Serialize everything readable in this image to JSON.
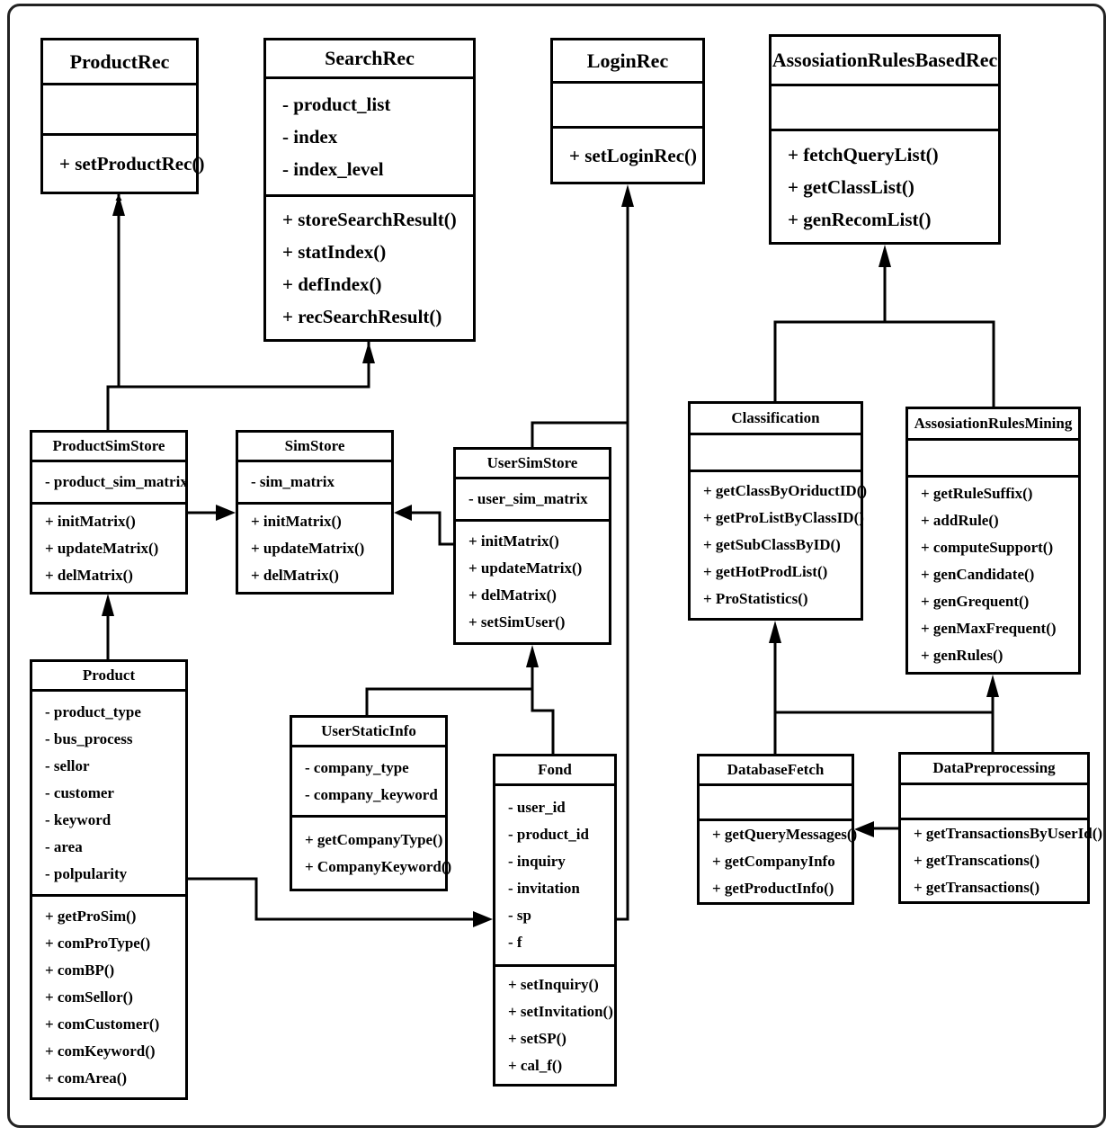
{
  "diagram": {
    "type": "UML class diagram",
    "classes": {
      "productRec": {
        "name": "ProductRec",
        "attributes": [],
        "operations": [
          "+ setProductRec()"
        ]
      },
      "searchRec": {
        "name": "SearchRec",
        "attributes": [
          "- product_list",
          "- index",
          "- index_level"
        ],
        "operations": [
          "+ storeSearchResult()",
          "+ statIndex()",
          "+ defIndex()",
          "+ recSearchResult()"
        ]
      },
      "loginRec": {
        "name": "LoginRec",
        "attributes": [],
        "operations": [
          "+ setLoginRec()"
        ]
      },
      "assocRulesBasedRec": {
        "name": "AssosiationRulesBasedRec",
        "attributes": [],
        "operations": [
          "+ fetchQueryList()",
          "+ getClassList()",
          "+ genRecomList()"
        ]
      },
      "productSimStore": {
        "name": "ProductSimStore",
        "attributes": [
          "- product_sim_matrix"
        ],
        "operations": [
          "+ initMatrix()",
          "+ updateMatrix()",
          "+ delMatrix()"
        ]
      },
      "simStore": {
        "name": "SimStore",
        "attributes": [
          "- sim_matrix"
        ],
        "operations": [
          "+ initMatrix()",
          "+ updateMatrix()",
          "+ delMatrix()"
        ]
      },
      "userSimStore": {
        "name": "UserSimStore",
        "attributes": [
          "- user_sim_matrix"
        ],
        "operations": [
          "+ initMatrix()",
          "+ updateMatrix()",
          "+ delMatrix()",
          "+ setSimUser()"
        ]
      },
      "classification": {
        "name": "Classification",
        "attributes": [],
        "operations": [
          "+ getClassByOriductID()",
          "+ getProListByClassID()",
          "+ getSubClassByID()",
          "+ getHotProdList()",
          "+ ProStatistics()"
        ]
      },
      "assocRulesMining": {
        "name": "AssosiationRulesMining",
        "attributes": [],
        "operations": [
          "+ getRuleSuffix()",
          "+ addRule()",
          "+ computeSupport()",
          "+ genCandidate()",
          "+ genGrequent()",
          "+ genMaxFrequent()",
          "+ genRules()"
        ]
      },
      "product": {
        "name": "Product",
        "attributes": [
          "- product_type",
          "- bus_process",
          "- sellor",
          "- customer",
          "- keyword",
          "- area",
          "- polpularity"
        ],
        "operations": [
          "+ getProSim()",
          "+ comProType()",
          "+ comBP()",
          "+ comSellor()",
          "+ comCustomer()",
          "+ comKeyword()",
          "+ comArea()"
        ]
      },
      "userStaticInfo": {
        "name": "UserStaticInfo",
        "attributes": [
          "- company_type",
          "- company_keyword"
        ],
        "operations": [
          "+ getCompanyType()",
          "+ CompanyKeyword()"
        ]
      },
      "fond": {
        "name": "Fond",
        "attributes": [
          "- user_id",
          "- product_id",
          "- inquiry",
          "- invitation",
          "- sp",
          "- f"
        ],
        "operations": [
          "+ setInquiry()",
          "+ setInvitation()",
          "+ setSP()",
          "+ cal_f()"
        ]
      },
      "databaseFetch": {
        "name": "DatabaseFetch",
        "attributes": [],
        "operations": [
          "+ getQueryMessages()",
          "+ getCompanyInfo",
          "+ getProductInfo()"
        ]
      },
      "dataPreprocessing": {
        "name": "DataPreprocessing",
        "attributes": [],
        "operations": [
          "+ getTransactionsByUserId()",
          "+ getTranscations()",
          "+ getTransactions()"
        ]
      }
    },
    "relations": [
      {
        "from": "ProductSimStore",
        "to": "ProductRec"
      },
      {
        "from": "ProductSimStore",
        "to": "SearchRec"
      },
      {
        "from": "ProductSimStore",
        "to": "SimStore"
      },
      {
        "from": "UserSimStore",
        "to": "SimStore"
      },
      {
        "from": "UserSimStore",
        "to": "LoginRec"
      },
      {
        "from": "Fond",
        "to": "LoginRec"
      },
      {
        "from": "Product",
        "to": "ProductSimStore"
      },
      {
        "from": "Product",
        "to": "Fond"
      },
      {
        "from": "UserStaticInfo",
        "to": "UserSimStore"
      },
      {
        "from": "Fond",
        "to": "UserSimStore"
      },
      {
        "from": "Classification",
        "to": "AssosiationRulesBasedRec"
      },
      {
        "from": "AssosiationRulesMining",
        "to": "AssosiationRulesBasedRec"
      },
      {
        "from": "DatabaseFetch",
        "to": "Classification"
      },
      {
        "from": "DatabaseFetch",
        "to": "AssosiationRulesMining"
      },
      {
        "from": "DataPreprocessing",
        "to": "AssosiationRulesMining"
      },
      {
        "from": "DataPreprocessing",
        "to": "DatabaseFetch"
      }
    ]
  }
}
